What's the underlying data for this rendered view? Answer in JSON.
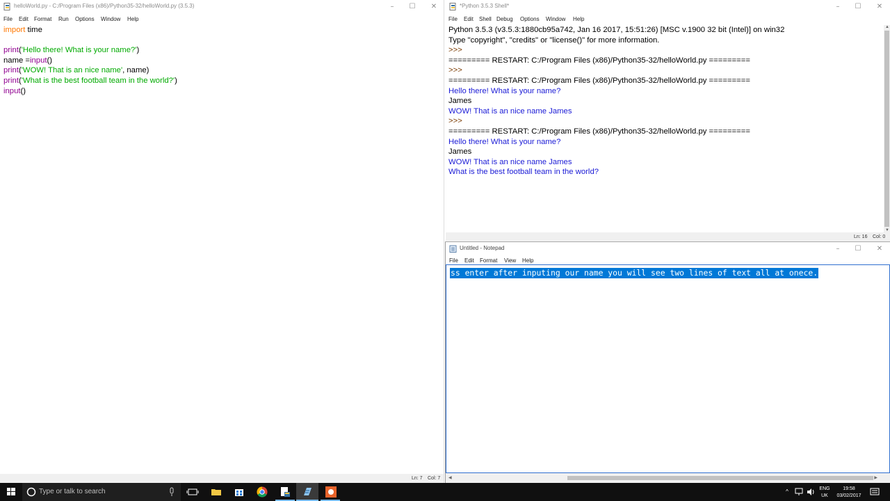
{
  "editor": {
    "title": "helloWorld.py - C:/Program Files (x86)/Python35-32/helloWorld.py (3.5.3)",
    "menu": [
      "File",
      "Edit",
      "Format",
      "Run",
      "Options",
      "Window",
      "Help"
    ],
    "code": {
      "import_kw": "import",
      "import_rest": " time",
      "l3_fn": "print",
      "l3_a": "(",
      "l3_s": "'Hello there! What is your name?'",
      "l3_b": ")",
      "l4_a": "name =",
      "l4_fn": "input",
      "l4_b": "()",
      "l5_fn": "print",
      "l5_a": "(",
      "l5_s": "'WOW! That is an nice name'",
      "l5_b": ", name)",
      "l6_fn": "print",
      "l6_a": "(",
      "l6_s": "'What is the best football team in the world?'",
      "l6_b": ")",
      "l7_fn": "input",
      "l7_b": "()"
    },
    "status": {
      "ln": "Ln: 7",
      "col": "Col: 7"
    }
  },
  "shell": {
    "title": "*Python 3.5.3 Shell*",
    "menu": [
      "File",
      "Edit",
      "Shell",
      "Debug",
      "Options",
      "Window",
      "Help"
    ],
    "lines": [
      {
        "text": "Python 3.5.3 (v3.5.3:1880cb95a742, Jan 16 2017, 15:51:26) [MSC v.1900 32 bit (Intel)] on win32",
        "kind": "sys"
      },
      {
        "text": "Type \"copyright\", \"credits\" or \"license()\" for more information.",
        "kind": "sys"
      },
      {
        "text": ">>> ",
        "kind": "prompt"
      },
      {
        "text": "========= RESTART: C:/Program Files (x86)/Python35-32/helloWorld.py =========",
        "kind": "sys"
      },
      {
        "text": ">>> ",
        "kind": "prompt"
      },
      {
        "text": "========= RESTART: C:/Program Files (x86)/Python35-32/helloWorld.py =========",
        "kind": "sys"
      },
      {
        "text": "Hello there! What is your name?",
        "kind": "out"
      },
      {
        "text": "James",
        "kind": "sys"
      },
      {
        "text": "WOW! That is an nice name James",
        "kind": "out"
      },
      {
        "text": ">>> ",
        "kind": "prompt"
      },
      {
        "text": "========= RESTART: C:/Program Files (x86)/Python35-32/helloWorld.py =========",
        "kind": "sys"
      },
      {
        "text": "Hello there! What is your name?",
        "kind": "out"
      },
      {
        "text": "James",
        "kind": "sys"
      },
      {
        "text": "WOW! That is an nice name James",
        "kind": "out"
      },
      {
        "text": "What is the best football team in the world?",
        "kind": "out"
      }
    ],
    "status": {
      "ln": "Ln: 16",
      "col": "Col: 0"
    }
  },
  "notepad": {
    "title": "Untitled - Notepad",
    "menu": [
      "File",
      "Edit",
      "Format",
      "View",
      "Help"
    ],
    "selected_text": "ss enter after inputing our name you will see two lines of text all at onece."
  },
  "taskbar": {
    "search_placeholder": "Type or talk to search",
    "lang": "ENG",
    "region": "UK",
    "time": "19:58",
    "date": "03/02/2017"
  },
  "colors": {
    "keyword": "#ff7700",
    "builtin": "#900090",
    "string": "#00aa00",
    "shell_output": "#1a1ad6",
    "selection": "#0078d7"
  }
}
